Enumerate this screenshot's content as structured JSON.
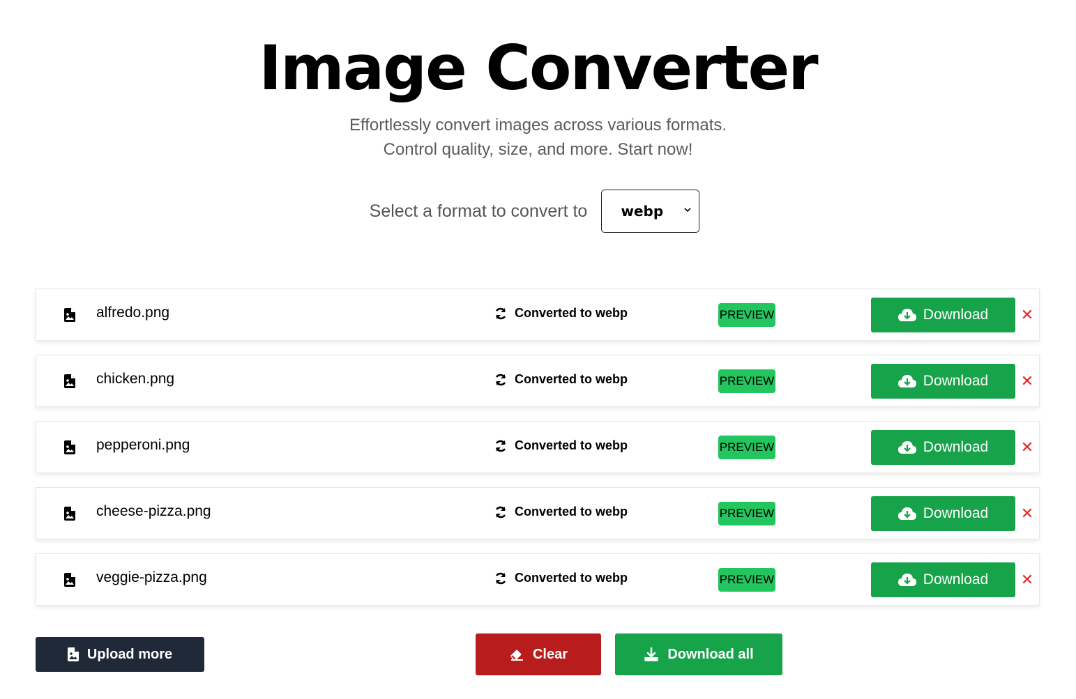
{
  "header": {
    "title": "Image Converter",
    "subtitle_line1": "Effortlessly convert images across various formats.",
    "subtitle_line2": "Control quality, size, and more. Start now!"
  },
  "format": {
    "label": "Select a format to convert to",
    "selected": "webp"
  },
  "files": [
    {
      "name": "alfredo.png",
      "status": "Converted to webp",
      "preview_label": "PREVIEW",
      "download_label": "Download",
      "remove_icon": "✕"
    },
    {
      "name": "chicken.png",
      "status": "Converted to webp",
      "preview_label": "PREVIEW",
      "download_label": "Download",
      "remove_icon": "✕"
    },
    {
      "name": "pepperoni.png",
      "status": "Converted to webp",
      "preview_label": "PREVIEW",
      "download_label": "Download",
      "remove_icon": "✕"
    },
    {
      "name": "cheese-pizza.png",
      "status": "Converted to webp",
      "preview_label": "PREVIEW",
      "download_label": "Download",
      "remove_icon": "✕"
    },
    {
      "name": "veggie-pizza.png",
      "status": "Converted to webp",
      "preview_label": "PREVIEW",
      "download_label": "Download",
      "remove_icon": "✕"
    }
  ],
  "actions": {
    "upload_more": "Upload more",
    "clear": "Clear",
    "download_all": "Download all"
  },
  "colors": {
    "green": "#16a34a",
    "preview_green": "#22c55e",
    "red": "#b91c1c",
    "remove_red": "#dc2626",
    "dark": "#1f2937"
  }
}
